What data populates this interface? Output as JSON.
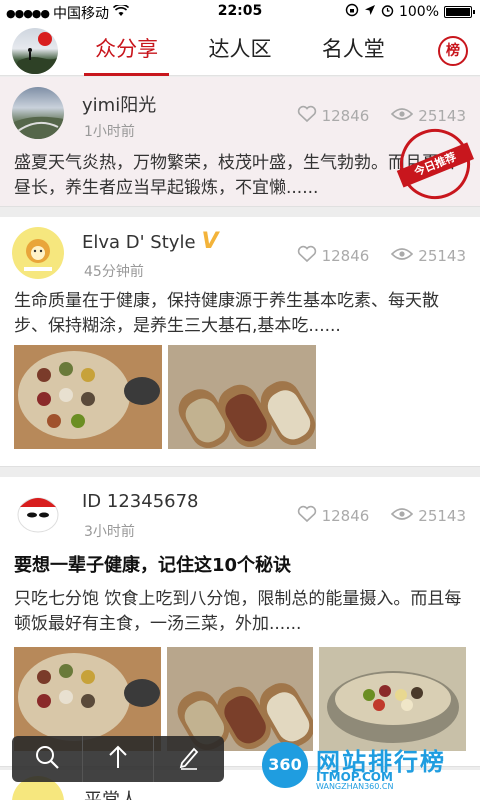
{
  "status": {
    "carrier": "中国移动",
    "time": "22:05",
    "battery": "100%",
    "battery_level": 1.0
  },
  "nav": {
    "tabs": [
      "众分享",
      "达人区",
      "名人堂"
    ],
    "active_tab": 0,
    "rank_badge": "榜"
  },
  "posts": [
    {
      "username": "yimi阳光",
      "time": "1小时前",
      "likes": "12846",
      "views": "25143",
      "excerpt": "盛夏天气炎热，万物繁荣，枝茂叶盛，生气勃勃。而且夏日昼长，养生者应当早起锻炼，不宜懒......",
      "stamp": "今日推荐"
    },
    {
      "username": "Elva D' Style",
      "time": "45分钟前",
      "likes": "12846",
      "views": "25143",
      "excerpt": "生命质量在于健康，保持健康源于养生基本吃素、每天散步、保持糊涂，是养生三大基石,基本吃......"
    },
    {
      "username": "ID 12345678",
      "time": "3小时前",
      "likes": "12846",
      "views": "25143",
      "headline": "要想一辈子健康，记住这10个秘诀",
      "excerpt": "只吃七分饱 饮食上吃到八分饱，限制总的能量摄入。而且每顿饭最好有主食，一汤三菜，外加......"
    },
    {
      "username": "平常人"
    }
  ],
  "watermark": {
    "logo": "360",
    "title": "网站排行榜",
    "site": "ITMOP.COM",
    "url": "WANGZHAN360.CN"
  },
  "colors": {
    "accent": "#c8161d",
    "watermark": "#1f9de0"
  }
}
